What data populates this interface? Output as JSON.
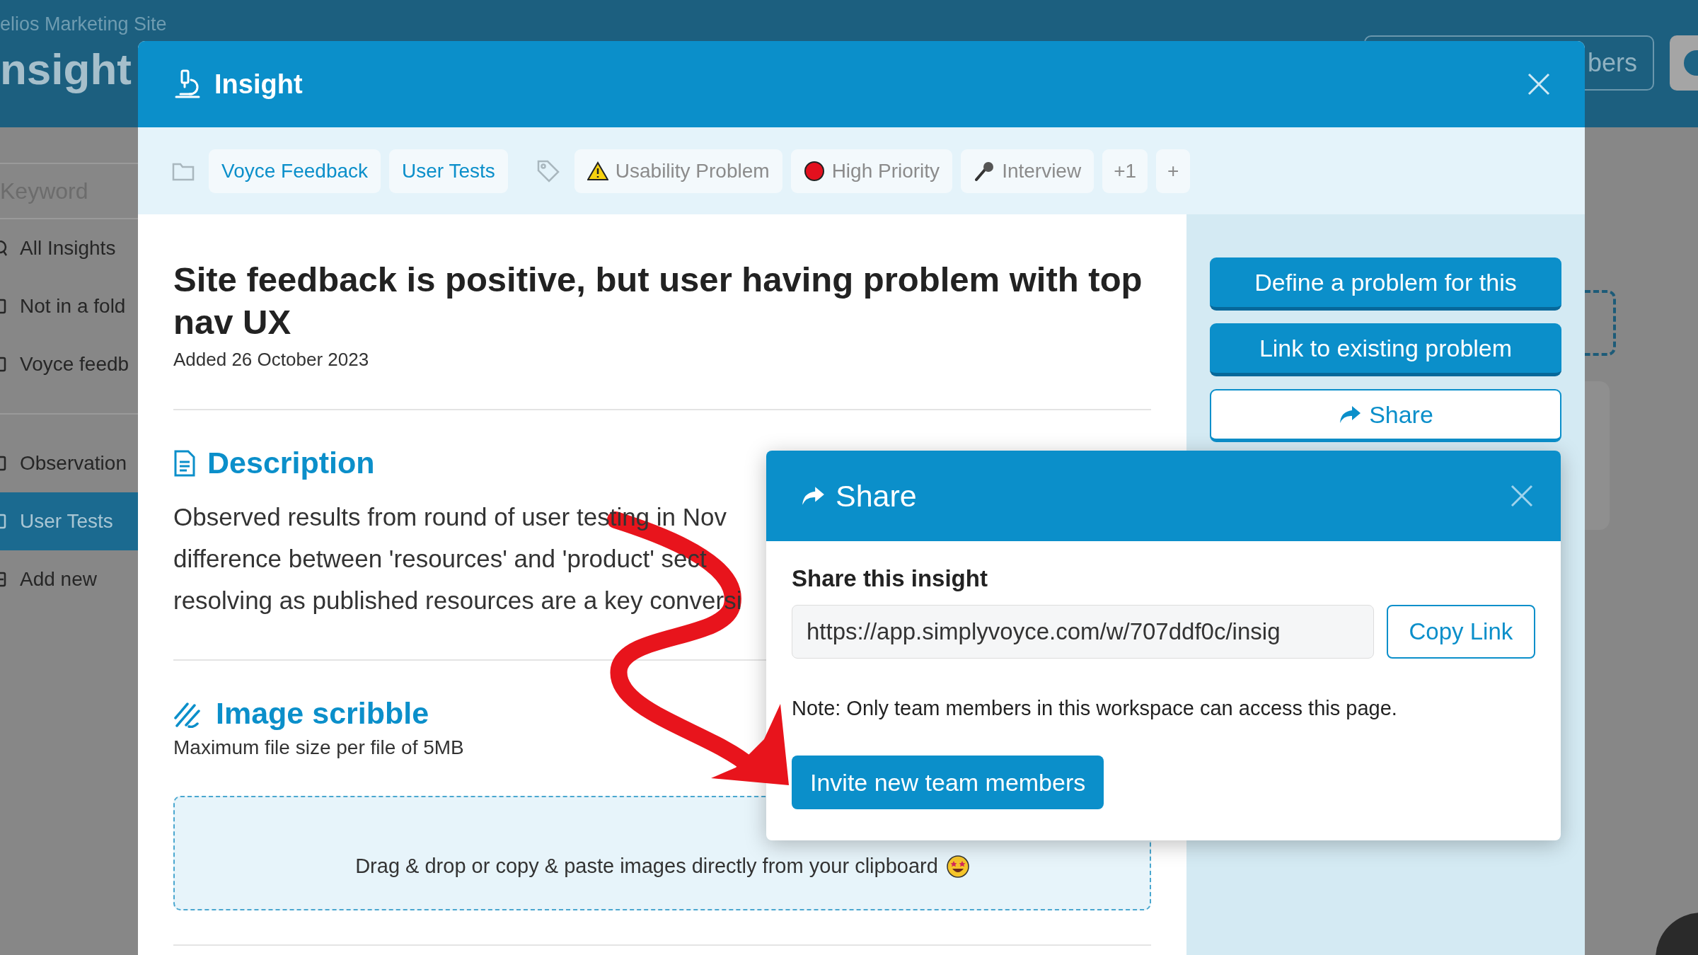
{
  "background": {
    "workspace": "elios Marketing Site",
    "page_title": "nsight",
    "header_button": "bers",
    "search": {
      "placeholder": "Keyword"
    },
    "sidebar": {
      "groups": [
        [
          {
            "label": "All Insights",
            "kind": "search",
            "selected": false
          },
          {
            "label": "Not in a fold",
            "kind": "folder",
            "selected": false
          },
          {
            "label": "Voyce feedb",
            "kind": "folder",
            "selected": false
          }
        ],
        [
          {
            "label": "Observation",
            "kind": "folder",
            "selected": false
          },
          {
            "label": "User Tests",
            "kind": "folder",
            "selected": true
          },
          {
            "label": "Add new",
            "kind": "add",
            "selected": false
          }
        ]
      ]
    }
  },
  "modal": {
    "title": "Insight",
    "folders": [
      "Voyce Feedback",
      "User Tests"
    ],
    "tags": [
      {
        "label": "Usability Problem",
        "kind": "warning"
      },
      {
        "label": "High Priority",
        "kind": "dot",
        "color": "#e3101e"
      },
      {
        "label": "Interview",
        "kind": "microphone"
      }
    ],
    "more_tags": "+1",
    "add_tag": "+",
    "heading": "Site feedback is positive, but user having problem with top nav UX",
    "added": "Added 26 October 2023",
    "description": {
      "title": "Description",
      "lines": [
        "Observed results from round of user testing in Nov",
        "difference between 'resources' and 'product' sect",
        "resolving as published resources are a key conversi"
      ]
    },
    "image_scribble": {
      "title": "Image scribble",
      "note": "Maximum file size per file of 5MB",
      "dropzone": "Drag & drop or copy & paste images directly from your clipboard"
    },
    "actions": [
      {
        "label": "Define a problem for this",
        "kind": "primary"
      },
      {
        "label": "Link to existing problem",
        "kind": "primary"
      },
      {
        "label": "Share",
        "kind": "outline"
      }
    ]
  },
  "share_popup": {
    "title": "Share",
    "heading": "Share this insight",
    "link": "https://app.simplyvoyce.com/w/707ddf0c/insig",
    "copy_button": "Copy Link",
    "note": "Note: Only team members in this workspace can access this page.",
    "invite_button": "Invite new team members"
  }
}
